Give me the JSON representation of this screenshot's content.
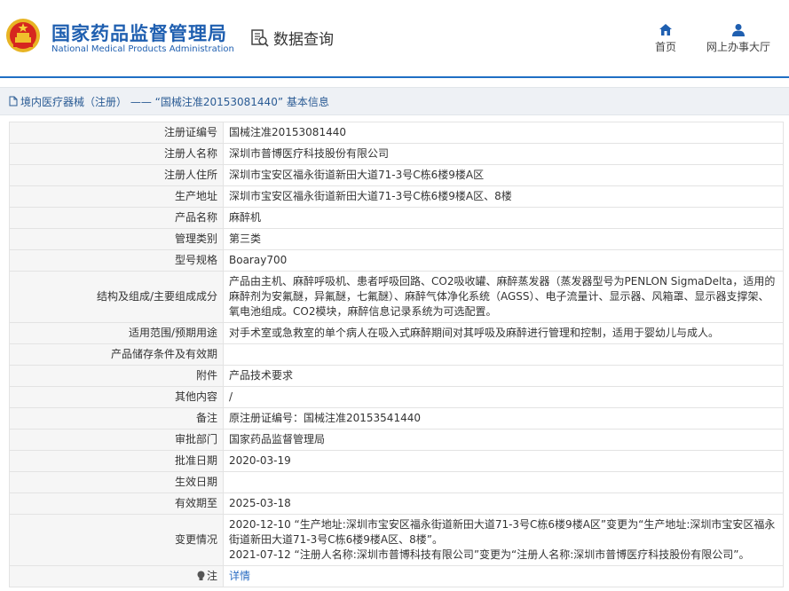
{
  "header": {
    "logo_cn": "国家药品监督管理局",
    "logo_en": "National Medical Products Administration",
    "data_query": "数据查询",
    "nav": [
      {
        "label": "首页",
        "icon": "home-icon"
      },
      {
        "label": "网上办事大厅",
        "icon": "user-icon"
      }
    ]
  },
  "breadcrumb": "境内医疗器械（注册） —— “国械注准20153081440” 基本信息",
  "rows": [
    {
      "label": "注册证编号",
      "value": "国械注准20153081440"
    },
    {
      "label": "注册人名称",
      "value": "深圳市普博医疗科技股份有限公司"
    },
    {
      "label": "注册人住所",
      "value": "深圳市宝安区福永街道新田大道71-3号C栋6楼9楼A区"
    },
    {
      "label": "生产地址",
      "value": "深圳市宝安区福永街道新田大道71-3号C栋6楼9楼A区、8楼"
    },
    {
      "label": "产品名称",
      "value": "麻醉机"
    },
    {
      "label": "管理类别",
      "value": "第三类"
    },
    {
      "label": "型号规格",
      "value": "Boaray700"
    },
    {
      "label": "结构及组成/主要组成成分",
      "value": "产品由主机、麻醉呼吸机、患者呼吸回路、CO2吸收罐、麻醉蒸发器（蒸发器型号为PENLON SigmaDelta，适用的麻醉剂为安氟醚，异氟醚，七氟醚）、麻醉气体净化系统（AGSS）、电子流量计、显示器、风箱罩、显示器支撑架、氧电池组成。CO2模块，麻醉信息记录系统为可选配置。"
    },
    {
      "label": "适用范围/预期用途",
      "value": "对手术室或急救室的单个病人在吸入式麻醉期间对其呼吸及麻醉进行管理和控制，适用于婴幼儿与成人。"
    },
    {
      "label": "产品储存条件及有效期",
      "value": ""
    },
    {
      "label": "附件",
      "value": "产品技术要求"
    },
    {
      "label": "其他内容",
      "value": "/"
    },
    {
      "label": "备注",
      "value": "原注册证编号：国械注准20153541440"
    },
    {
      "label": "审批部门",
      "value": "国家药品监督管理局"
    },
    {
      "label": "批准日期",
      "value": "2020-03-19"
    },
    {
      "label": "生效日期",
      "value": ""
    },
    {
      "label": "有效期至",
      "value": "2025-03-18"
    }
  ],
  "change_label": "变更情况",
  "changes": [
    "2020-12-10 “生产地址:深圳市宝安区福永街道新田大道71-3号C栋6楼9楼A区”变更为“生产地址:深圳市宝安区福永街道新田大道71-3号C栋6楼9楼A区、8楼”。",
    "2021-07-12 “注册人名称:深圳市普博科技有限公司”变更为“注册人名称:深圳市普博医疗科技股份有限公司”。"
  ],
  "note_label": "注",
  "note_link": "详情",
  "colors": {
    "brand": "#1f5fb0",
    "label_bg": "#f6f6f6",
    "link": "#2a6cc2"
  }
}
